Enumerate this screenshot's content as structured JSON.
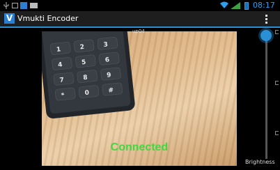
{
  "status_bar": {
    "time": "08:17"
  },
  "app": {
    "title": "Vmukti Encoder",
    "logo_letter": "V"
  },
  "video": {
    "label": "up04",
    "status": "Connected"
  },
  "brightness": {
    "label": "Brightness",
    "level": 0.02
  },
  "colors": {
    "accent": "#2b8fd6",
    "status_connected": "#3fd83f"
  },
  "icons": [
    "usb-icon",
    "sim-icon",
    "app-notification-icon",
    "message-icon",
    "wifi-icon",
    "signal-icon",
    "battery-icon",
    "overflow-menu-icon"
  ]
}
